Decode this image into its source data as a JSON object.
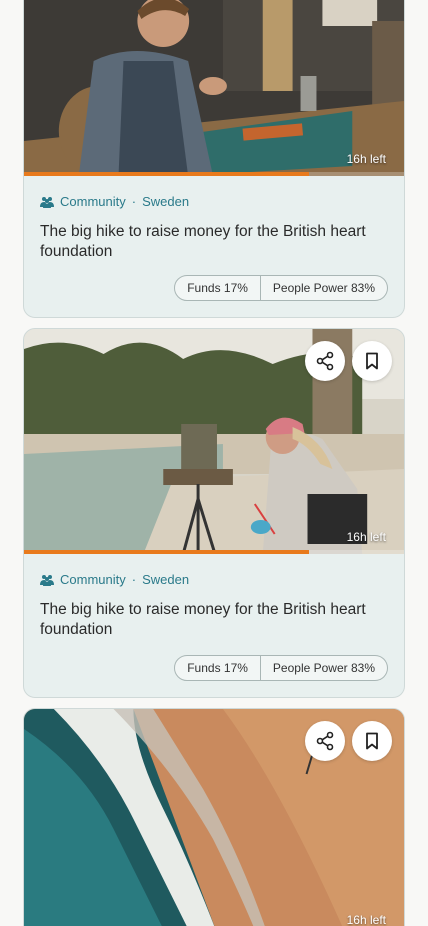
{
  "cards": [
    {
      "image_subject": "Artisan stitching leather at a workbench",
      "time_left": "16h left",
      "progress_percent": 75,
      "category": "Community",
      "location": "Sweden",
      "separator": "·",
      "title": "The big hike to raise money for the British heart foundation",
      "funds_label": "Funds 17%",
      "people_power_label": "People Power 83%",
      "share_icon": "share-icon",
      "save_icon": "bookmark-icon"
    },
    {
      "image_subject": "Painter at an easel on a palm-lined beach",
      "time_left": "16h left",
      "progress_percent": 75,
      "category": "Community",
      "location": "Sweden",
      "separator": "·",
      "title": "The big hike to raise money for the British heart foundation",
      "funds_label": "Funds 17%",
      "people_power_label": "People Power 83%",
      "share_icon": "share-icon",
      "save_icon": "bookmark-icon"
    },
    {
      "image_subject": "Aerial view of ocean waves meeting a sandy beach",
      "time_left": "16h left",
      "share_icon": "share-icon",
      "save_icon": "bookmark-icon"
    }
  ],
  "colors": {
    "accent_teal": "#2a7a8a",
    "progress_orange": "#e87a1c",
    "card_background": "#e8f0ef"
  }
}
